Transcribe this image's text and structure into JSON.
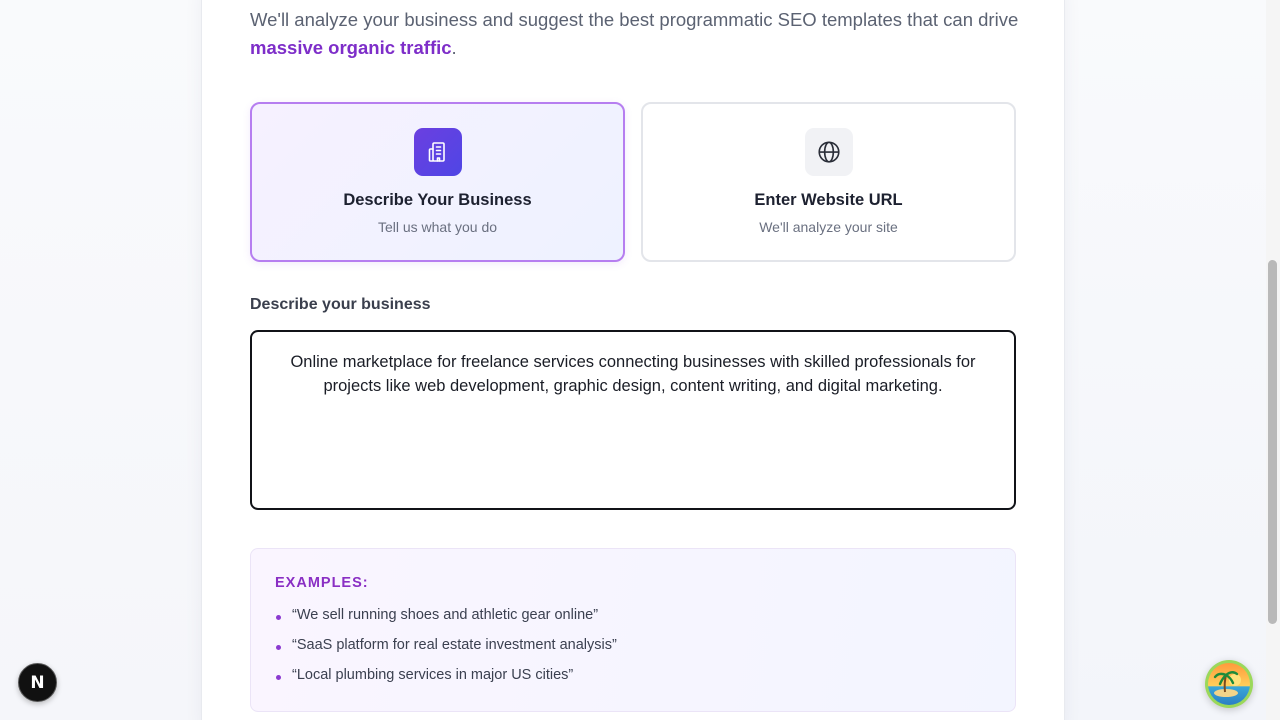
{
  "intro": {
    "text_before": "We'll analyze your business and suggest the best programmatic SEO templates that can drive ",
    "highlight": "massive organic traffic",
    "text_after": "."
  },
  "options": [
    {
      "title": "Describe Your Business",
      "subtitle": "Tell us what you do",
      "icon": "building-icon",
      "selected": true
    },
    {
      "title": "Enter Website URL",
      "subtitle": "We'll analyze your site",
      "icon": "globe-icon",
      "selected": false
    }
  ],
  "business_field": {
    "label": "Describe your business",
    "value": "Online marketplace for freelance services connecting businesses with skilled professionals for projects like web development, graphic design, content writing, and digital marketing."
  },
  "examples": {
    "heading": "EXAMPLES:",
    "items": [
      "“We sell running shoes and athletic gear online”",
      "“SaaS platform for real estate investment analysis”",
      "“Local plumbing services in major US cities”"
    ]
  },
  "dev_badge": {
    "letter": "N",
    "icon": "nextjs-logo-icon"
  },
  "assistant_button": {
    "icon": "beach-island-icon"
  },
  "colors": {
    "accent": "#7e2ec9",
    "selected_border": "#b67ef0",
    "icon_gradient_start": "#6b3fe0",
    "icon_gradient_end": "#4f46e5",
    "bullet": "#8b3ad0"
  }
}
